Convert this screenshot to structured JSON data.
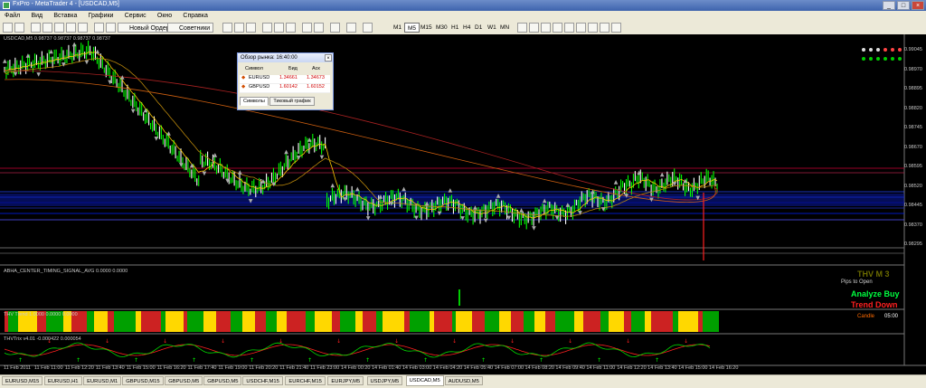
{
  "window": {
    "title": "FxPro - MetaTrader 4 - [USDCAD,M5]"
  },
  "menu": [
    "Файл",
    "Вид",
    "Вставка",
    "Графики",
    "Сервис",
    "Окно",
    "Справка"
  ],
  "toolbar": {
    "new_order": "Новый Ордер",
    "advisors": "Советники",
    "timeframes": [
      "M1",
      "M5",
      "M15",
      "M30",
      "H1",
      "H4",
      "D1",
      "W1",
      "MN"
    ],
    "active_timeframe": "M5"
  },
  "chart": {
    "header": "USDCAD,M5  0.98737 0.98737 0.98737 0.98737",
    "price_axis": [
      "0.99045",
      "0.98970",
      "0.98895",
      "0.98820",
      "0.98745",
      "0.98670",
      "0.98595",
      "0.98520",
      "0.98445",
      "0.98370",
      "0.98295"
    ],
    "time_axis": [
      "11 Feb 2011",
      "11 Feb 11:00",
      "11 Feb 12:20",
      "11 Feb 13:40",
      "11 Feb 15:00",
      "11 Feb 16:20",
      "11 Feb 17:40",
      "11 Feb 19:00",
      "11 Feb 20:20",
      "11 Feb 21:40",
      "11 Feb 23:00",
      "14 Feb 00:20",
      "14 Feb 01:40",
      "14 Feb 03:00",
      "14 Feb 04:20",
      "14 Feb 05:40",
      "14 Feb 07:00",
      "14 Feb 08:20",
      "14 Feb 09:40",
      "14 Feb 11:00",
      "14 Feb 12:20",
      "14 Feb 13:40",
      "14 Feb 15:00",
      "14 Feb 16:20"
    ],
    "indicator1_label": "ABHA_CENTER_TIMING_SIGNAL_AVG 0.0000 0.0000",
    "indicator2_label": "THV Trend 1.0000 0.0000 0.0000",
    "indicator3_label": "THVTrix v4.01 -0.000422 0.000054",
    "thv_title": "THV M 3",
    "pips_to_open": "Pips to Open",
    "analyze": "Analyze Buy",
    "trend": "Trend Down",
    "candle_label": "Candle",
    "candle_time": "05:00"
  },
  "market_watch": {
    "title": "Обзор рынка: 16:40:00",
    "headers": [
      "Символ",
      "Бид",
      "Аск"
    ],
    "rows": [
      {
        "symbol": "EURUSD",
        "bid": "1.34661",
        "ask": "1.34673"
      },
      {
        "symbol": "GBPUSD",
        "bid": "1.60142",
        "ask": "1.60152"
      }
    ],
    "tabs": [
      "Символы",
      "Тиковый график"
    ]
  },
  "chart_tabs": [
    "EURUSD,M15",
    "EURUSD,H1",
    "EURUSD,M1",
    "GBPUSD,M15",
    "GBPUSD,M5",
    "GBPUSD,M5",
    "USDCHF,M15",
    "EURCHF,M15",
    "EURJPY,M5",
    "USDJPY,M5",
    "USDCAD,M5",
    "AUDUSD,M5"
  ],
  "active_chart_tab": 10,
  "colors": {
    "bull": "#00ff00",
    "bear": "#ff0000",
    "trend_yellow": "#ffd800",
    "trend_red": "#cc2222",
    "trend_green": "#00a000"
  }
}
